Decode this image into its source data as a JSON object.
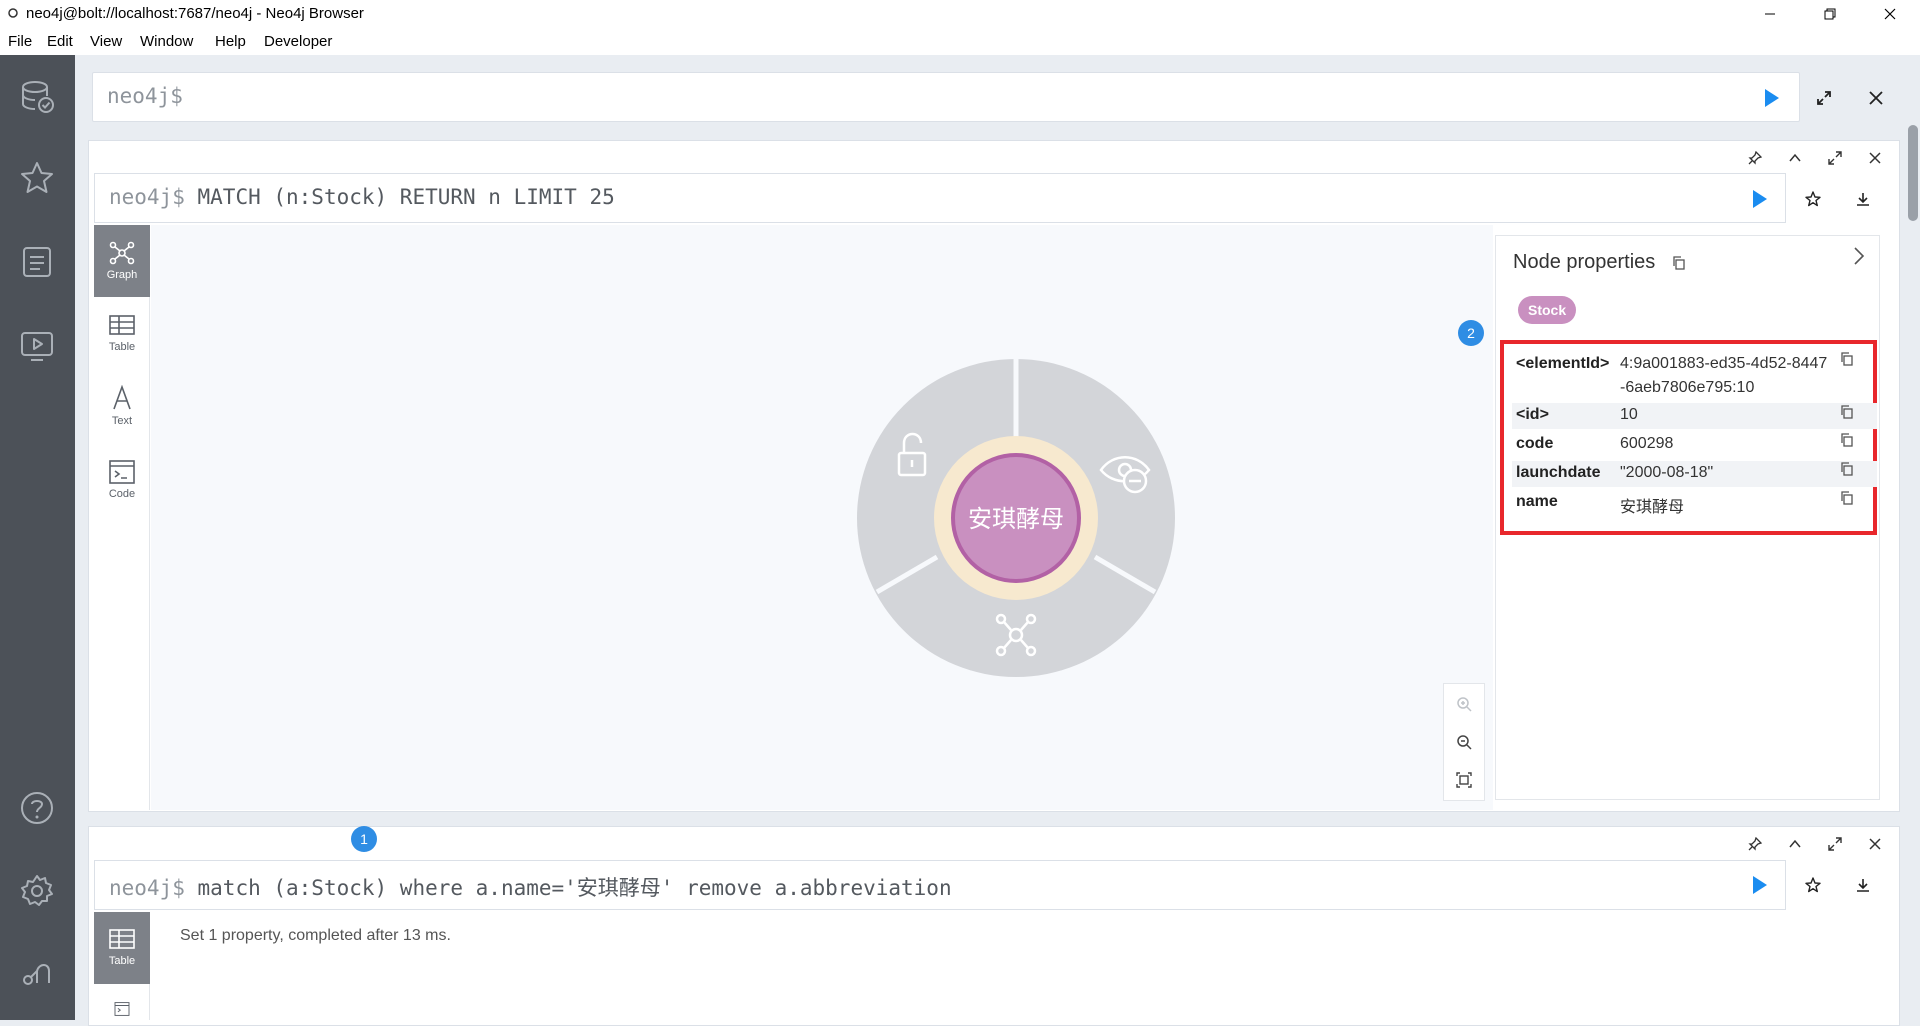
{
  "window": {
    "title": "neo4j@bolt://localhost:7687/neo4j - Neo4j Browser"
  },
  "menu": [
    "File",
    "Edit",
    "View",
    "Window",
    "Help",
    "Developer"
  ],
  "sidebar_icons": [
    "database-icon",
    "star-icon",
    "document-icon",
    "play-guide-icon",
    "help-icon",
    "settings-icon",
    "neo4j-logo-icon"
  ],
  "top_editor": {
    "prompt": "neo4j$"
  },
  "frame1": {
    "prompt": "neo4j$",
    "query": "MATCH (n:Stock) RETURN n LIMIT 25",
    "tabs": [
      {
        "label": "Graph",
        "icon": "graph-icon",
        "active": true
      },
      {
        "label": "Table",
        "icon": "table-icon",
        "active": false
      },
      {
        "label": "Text",
        "icon": "text-icon",
        "active": false
      },
      {
        "label": "Code",
        "icon": "code-icon",
        "active": false
      }
    ],
    "node": {
      "caption": "安琪酵母",
      "color": "#c990c0",
      "border": "#b261a5"
    },
    "properties": {
      "title": "Node properties",
      "label": "Stock",
      "label_color": "#c990c0",
      "callout_number": "2",
      "highlight_color": "#e8272c",
      "rows": [
        {
          "key": "<elementId>",
          "value": "4:9a001883-ed35-4d52-8447-6aeb7806e795:10"
        },
        {
          "key": "<id>",
          "value": "10"
        },
        {
          "key": "code",
          "value": "600298"
        },
        {
          "key": "launchdate",
          "value": "\"2000-08-18\""
        },
        {
          "key": "name",
          "value": "安琪酵母"
        }
      ]
    }
  },
  "frame2": {
    "callout_number": "1",
    "prompt": "neo4j$",
    "query": "match (a:Stock) where a.name='安琪酵母' remove a.abbreviation",
    "tabs": [
      {
        "label": "Table",
        "icon": "table-icon",
        "active": true
      },
      {
        "label": "",
        "icon": "code-icon",
        "active": false
      }
    ],
    "result": "Set 1 property, completed after 13 ms."
  },
  "colors": {
    "accent": "#1a8cf0",
    "sidebar": "#4c5158"
  }
}
